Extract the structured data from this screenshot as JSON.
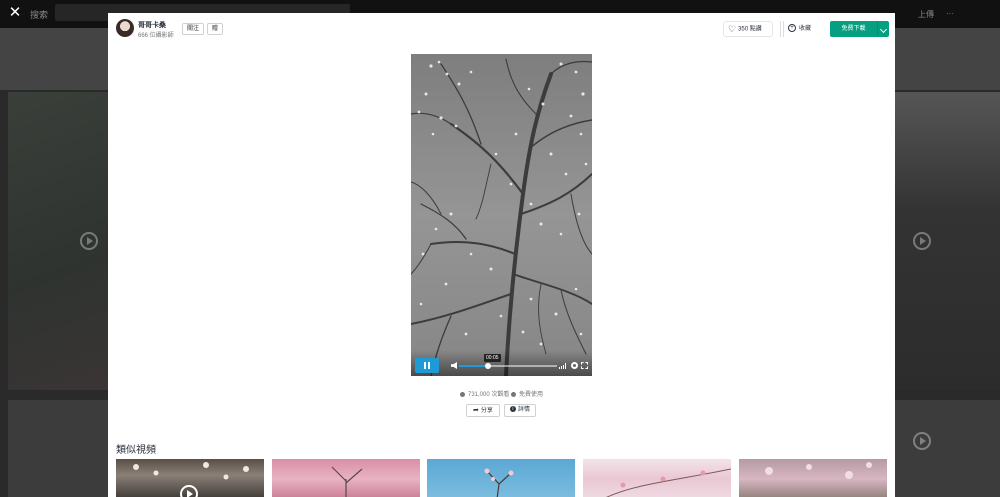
{
  "app": {
    "close_label": "✕",
    "search_label": "搜索",
    "top_right_items": [
      "上傳",
      "···"
    ]
  },
  "author": {
    "name": "哥哥卡桑",
    "subtitle": "666 位攝影師",
    "follow_label": "關注",
    "gift_label": "贈"
  },
  "actions": {
    "like_label": "350 點讚",
    "collect_label": "收藏",
    "download_label": "免費下載"
  },
  "player": {
    "time_tooltip": "00:05",
    "progress_fraction": 0.3
  },
  "stats": {
    "views": "731,000 次觀看",
    "license": "免費使用"
  },
  "buttons": {
    "share_label": "分享",
    "info_label": "詳情"
  },
  "related": {
    "title": "類似視頻"
  },
  "icons": [
    "close-icon",
    "heart-icon",
    "plus-circle-icon",
    "chevron-down-icon",
    "pause-icon",
    "volume-icon",
    "quality-icon",
    "gear-icon",
    "fullscreen-icon",
    "eye-icon",
    "check-icon",
    "share-icon",
    "info-icon",
    "play-icon"
  ],
  "colors": {
    "accent_green": "#05a081",
    "player_blue": "#1e9bd7"
  }
}
